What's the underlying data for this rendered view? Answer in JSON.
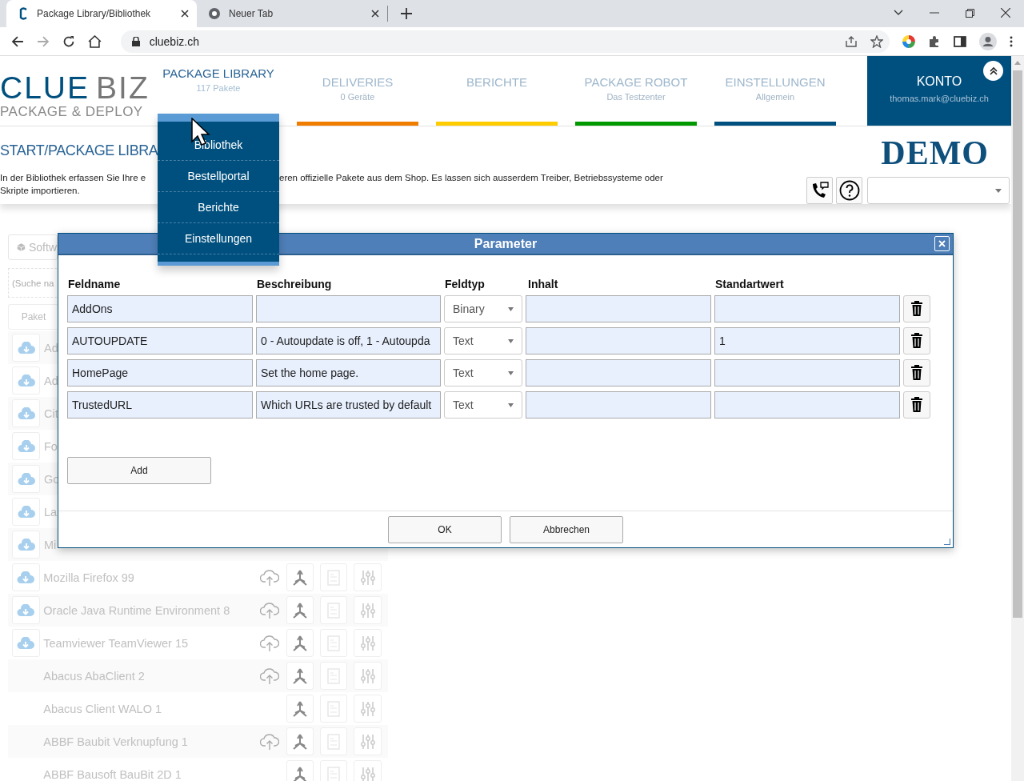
{
  "browser": {
    "tabs": [
      {
        "title": "Package Library/Bibliothek",
        "selected": true
      },
      {
        "title": "Neuer Tab",
        "selected": false
      }
    ],
    "url": "cluebiz.ch"
  },
  "logo": {
    "word_1": "CLUE",
    "word_2": "BIZ",
    "tagline": "PACKAGE & DEPLOY"
  },
  "nav": [
    {
      "label": "PACKAGE LIBRARY",
      "sublabel": "117 Pakete",
      "selected": true,
      "color": "#5b9bd5"
    },
    {
      "label": "DELIVERIES",
      "sublabel": "0 Geräte",
      "selected": false,
      "color": "#f07d00"
    },
    {
      "label": "BERICHTE",
      "selected": false,
      "color": "#ffcc00"
    },
    {
      "label": "PACKAGE ROBOT",
      "sublabel": "Das Testzenter",
      "selected": false,
      "color": "#009900"
    },
    {
      "label": "EINSTELLUNGEN",
      "sublabel": "Allgemein",
      "selected": false,
      "color": "#00507f"
    }
  ],
  "account": {
    "label": "KONTO",
    "email": "thomas.mark@cluebiz.ch"
  },
  "page": {
    "breadcrumb": "START/PACKAGE LIBRA",
    "description_left": "In der Bibliothek erfassen Sie Ihre e",
    "description_right": "eren offizielle Pakete aus dem Shop. Es lassen sich ausserdem Treiber, Betriebssysteme oder",
    "description_line_2": "Skripte importieren.",
    "demo_badge": "DEMO"
  },
  "dropdown_menu": {
    "items": [
      "Bibliothek",
      "Bestellportal",
      "Berichte",
      "Einstellungen"
    ]
  },
  "library": {
    "software_button": "Softw",
    "search_placeholder": "(Suche na",
    "column_header": "Paket",
    "rows": [
      {
        "name": "Ad",
        "download": true,
        "upload": false,
        "actions": false
      },
      {
        "name": "Ad",
        "download": true,
        "upload": false,
        "actions": false
      },
      {
        "name": "Cit",
        "download": true,
        "upload": false,
        "actions": false
      },
      {
        "name": "Fo",
        "download": true,
        "upload": false,
        "actions": false
      },
      {
        "name": "Go",
        "download": true,
        "upload": false,
        "actions": false
      },
      {
        "name": "La",
        "download": true,
        "upload": false,
        "actions": false
      },
      {
        "name": "Mi",
        "download": true,
        "upload": false,
        "actions": false
      },
      {
        "name": "Mozilla Firefox 99",
        "download": true,
        "upload": true,
        "actions": true
      },
      {
        "name": "Oracle Java Runtime Environment 8",
        "download": true,
        "upload": true,
        "actions": true
      },
      {
        "name": "Teamviewer TeamViewer 15",
        "download": true,
        "upload": true,
        "actions": true
      },
      {
        "name": "Abacus AbaClient 2",
        "download": false,
        "upload": true,
        "actions": true
      },
      {
        "name": "Abacus Client WALO 1",
        "download": false,
        "upload": false,
        "actions": true
      },
      {
        "name": "ABBF Baubit Verknupfung 1",
        "download": false,
        "upload": true,
        "actions": true
      },
      {
        "name": "ABBF Bausoft BauBit 2D 1",
        "download": false,
        "upload": false,
        "actions": true
      }
    ]
  },
  "dialog": {
    "title": "Parameter",
    "columns": [
      "Feldname",
      "Beschreibung",
      "Feldtyp",
      "Inhalt",
      "Standartwert"
    ],
    "rows": [
      {
        "name": "AddOns",
        "type": "Binary"
      },
      {
        "name": "AUTOUPDATE",
        "description": "0 - Autoupdate is off, 1 - Autoupda",
        "type": "Text",
        "default": "1"
      },
      {
        "name": "HomePage",
        "description": "Set the home page.",
        "type": "Text"
      },
      {
        "name": "TrustedURL",
        "description": "Which URLs are trusted by default",
        "type": "Text"
      }
    ],
    "add_button": "Add",
    "ok_button": "OK",
    "cancel_button": "Abbrechen"
  }
}
